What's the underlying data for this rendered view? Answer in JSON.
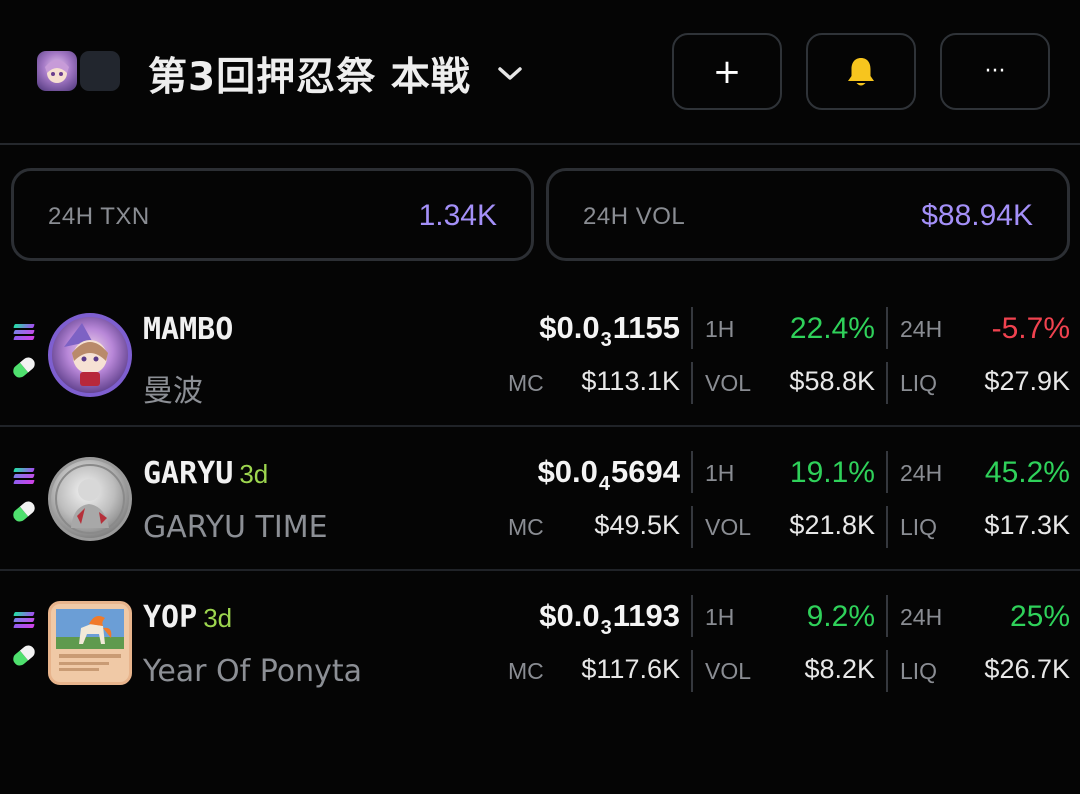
{
  "header": {
    "title": "第3回押忍祭 本戦",
    "add_label": "+",
    "more_label": "···"
  },
  "stats": {
    "txn": {
      "label": "24H TXN",
      "value": "1.34K"
    },
    "vol": {
      "label": "24H VOL",
      "value": "$88.94K"
    }
  },
  "colors": {
    "accent": "#a490f8",
    "positive": "#2fd15a",
    "negative": "#f0424f",
    "age": "#9dd64f",
    "bell": "#f7c51e"
  },
  "tokens": [
    {
      "symbol": "MAMBO",
      "age": "",
      "name": "曼波",
      "price_prefix": "$0.0",
      "price_zeros": "3",
      "price_digits": "1155",
      "mc_label": "MC",
      "mc": "$113.1K",
      "h1_label": "1H",
      "h1": "22.4%",
      "vol_label": "VOL",
      "vol": "$58.8K",
      "h24_label": "24H",
      "h24": "-5.7%",
      "liq_label": "LIQ",
      "liq": "$27.9K",
      "avatar_icon": "mambo-avatar-icon"
    },
    {
      "symbol": "GARYU",
      "age": "3d",
      "name": "GARYU TIME",
      "price_prefix": "$0.0",
      "price_zeros": "4",
      "price_digits": "5694",
      "mc_label": "MC",
      "mc": "$49.5K",
      "h1_label": "1H",
      "h1": "19.1%",
      "vol_label": "VOL",
      "vol": "$21.8K",
      "h24_label": "24H",
      "h24": "45.2%",
      "liq_label": "LIQ",
      "liq": "$17.3K",
      "avatar_icon": "garyu-coin-avatar-icon"
    },
    {
      "symbol": "YOP",
      "age": "3d",
      "name": "Year Of Ponyta",
      "price_prefix": "$0.0",
      "price_zeros": "3",
      "price_digits": "1193",
      "mc_label": "MC",
      "mc": "$117.6K",
      "h1_label": "1H",
      "h1": "9.2%",
      "vol_label": "VOL",
      "vol": "$8.2K",
      "h24_label": "24H",
      "h24": "25%",
      "liq_label": "LIQ",
      "liq": "$26.7K",
      "avatar_icon": "ponyta-card-avatar-icon"
    }
  ]
}
